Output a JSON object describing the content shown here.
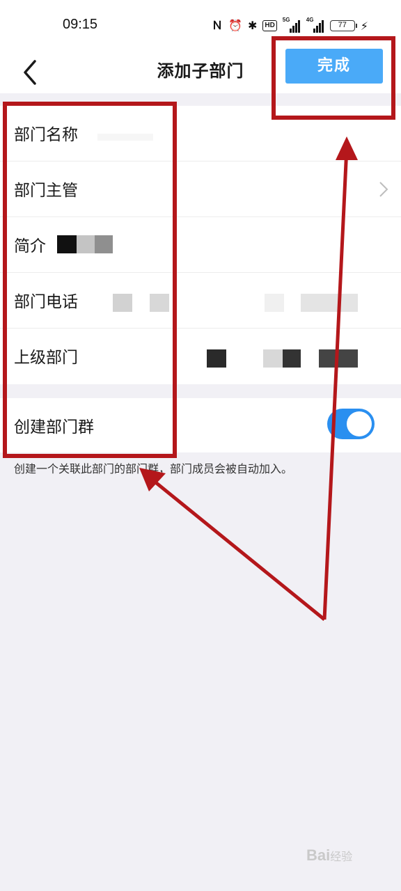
{
  "status_bar": {
    "time": "09:15",
    "icons": [
      "nfc-icon",
      "alarm-icon",
      "bluetooth-icon",
      "hd-icon",
      "signal-5g-icon",
      "signal-4g-icon",
      "battery-icon",
      "charging-icon"
    ],
    "hd_label": "HD",
    "net1": "5G",
    "net2": "4G",
    "battery": "77"
  },
  "navbar": {
    "title": "添加子部门",
    "done_label": "完成"
  },
  "form": {
    "rows": [
      {
        "label": "部门名称"
      },
      {
        "label": "部门主管"
      },
      {
        "label": "简介"
      },
      {
        "label": "部门电话"
      },
      {
        "label": "上级部门"
      }
    ],
    "create_group": {
      "label": "创建部门群",
      "enabled": true,
      "hint": "创建一个关联此部门的部门群，部门成员会被自动加入。"
    }
  },
  "colors": {
    "accent": "#4aaaf8",
    "toggle_on": "#2a8ff0",
    "annotation": "#b4171b",
    "background": "#f1f0f5"
  },
  "watermark": {
    "text": "Bai",
    "suffix": "经验"
  }
}
